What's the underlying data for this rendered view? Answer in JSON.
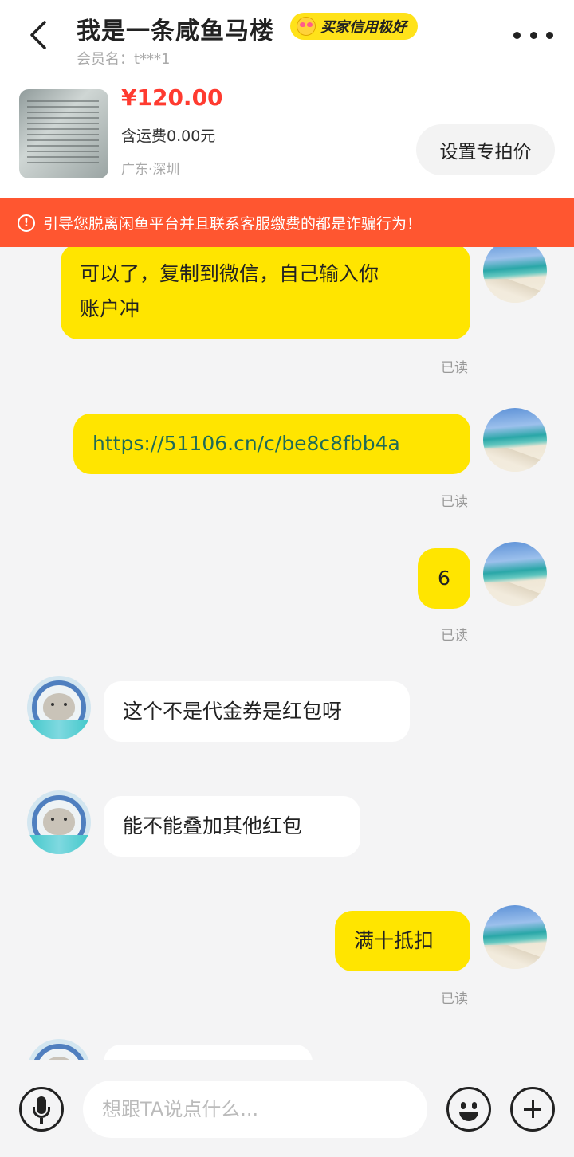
{
  "header": {
    "title": "我是一条咸鱼马楼",
    "badge_label": "买家信用极好",
    "member_label": "会员名：t***1",
    "icons": {
      "back": "chevron-left-icon",
      "more": "more-horizontal-icon"
    }
  },
  "product": {
    "price": "¥120.00",
    "shipping": "含运费0.00元",
    "location": "广东·深圳",
    "special_price_button": "设置专拍价"
  },
  "warning": {
    "text": "引导您脱离闲鱼平台并且联系客服缴费的都是诈骗行为！",
    "icon": "!"
  },
  "messages": [
    {
      "sender": "me",
      "lines": [
        "可以了，复制到微信，自己输入你",
        "账户冲"
      ],
      "status": "已读"
    },
    {
      "sender": "me",
      "text": "https://51106.cn/c/be8c8fbb4a",
      "status": "已读"
    },
    {
      "sender": "me",
      "text": "6",
      "status": "已读"
    },
    {
      "sender": "them",
      "text": "这个不是代金券是红包呀"
    },
    {
      "sender": "them",
      "text": "能不能叠加其他红包"
    },
    {
      "sender": "me",
      "text": "满十抵扣",
      "status": "已读"
    },
    {
      "sender": "them",
      "text": ""
    }
  ],
  "composer": {
    "placeholder": "想跟TA说点什么...",
    "icons": {
      "voice": "microphone-icon",
      "emoji": "emoji-icon",
      "more": "plus-icon"
    }
  },
  "colors": {
    "accent": "#ffe500",
    "warning": "#ff5630",
    "price": "#ff3b30"
  }
}
